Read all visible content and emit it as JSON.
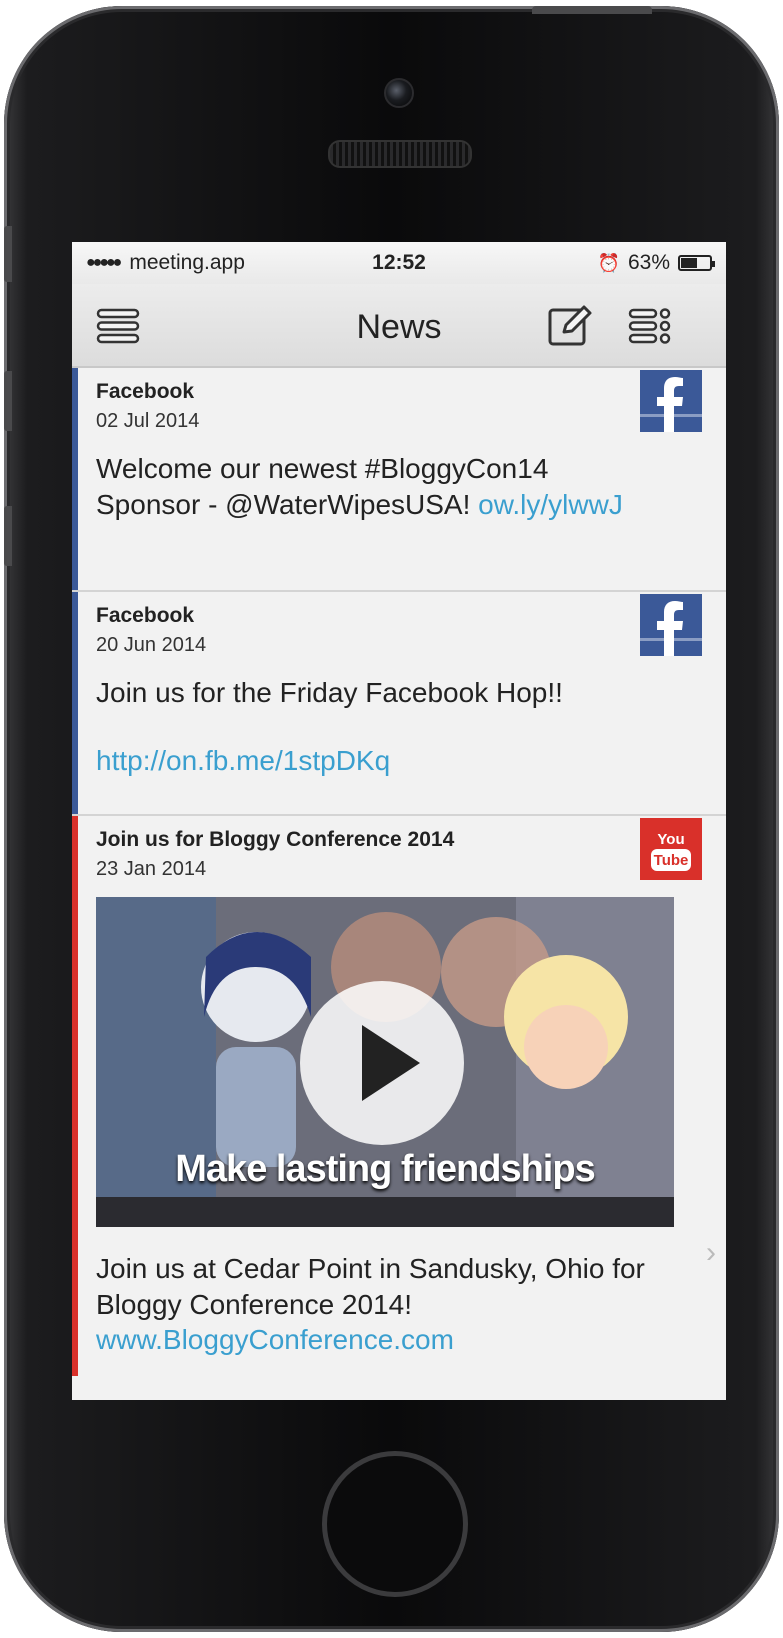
{
  "status": {
    "carrier": "meeting.app",
    "time": "12:52",
    "battery": "63%",
    "battery_level": 0.63
  },
  "nav": {
    "title": "News",
    "menu_icon": "hamburger-icon",
    "compose_icon": "compose-icon",
    "list_icon": "list-options-icon"
  },
  "posts": [
    {
      "source": "Facebook",
      "date": "02 Jul 2014",
      "text": "Welcome our newest #BloggyCon14 Sponsor - @WaterWipesUSA! ",
      "link": "ow.ly/ylwwJ",
      "icon": "facebook-icon",
      "accent": "#3b5998"
    },
    {
      "source": "Facebook",
      "date": "20 Jun 2014",
      "text": "Join us for the Friday Facebook Hop!!",
      "link": "http://on.fb.me/1stpDKq",
      "icon": "facebook-icon",
      "accent": "#3b5998"
    },
    {
      "source": "Join us for Bloggy Conference 2014",
      "date": "23 Jan 2014",
      "video_caption": "Make lasting friendships",
      "text": "Join us at Cedar Point in Sandusky, Ohio for Bloggy Conference 2014!",
      "link": "www.BloggyConference.com",
      "icon": "youtube-icon",
      "badge_line1": "You",
      "badge_line2": "Tube",
      "accent": "#d9302a"
    }
  ],
  "colors": {
    "link": "#3a9fcf",
    "facebook": "#3b5998",
    "youtube": "#d9302a"
  }
}
